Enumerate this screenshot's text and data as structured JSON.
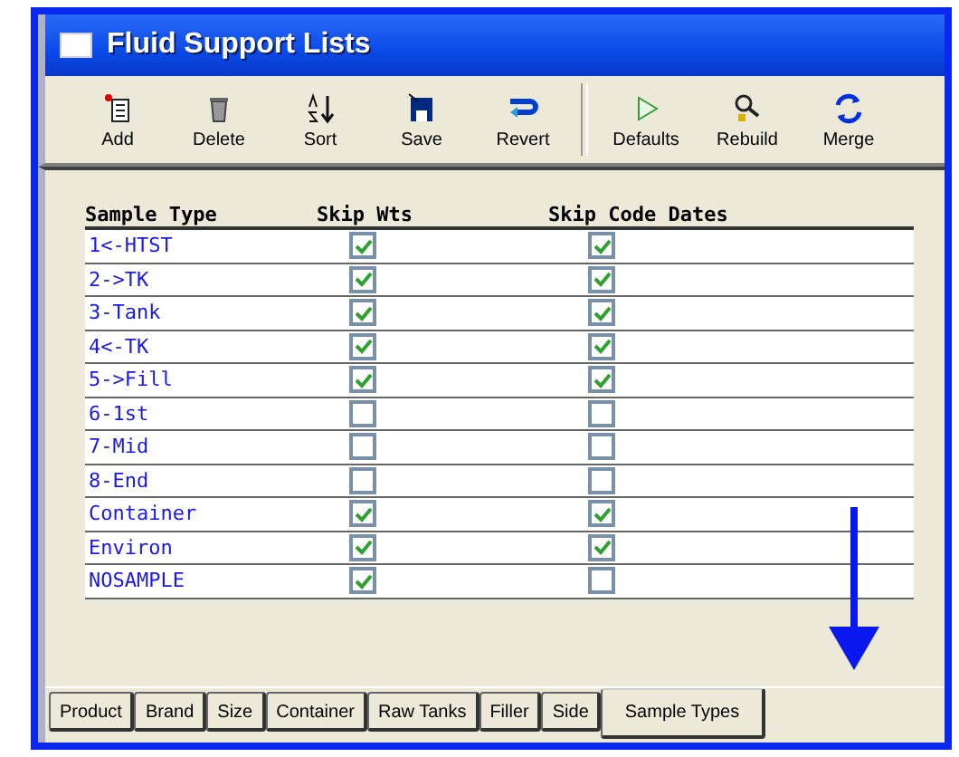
{
  "window": {
    "title": "Fluid Support Lists"
  },
  "toolbar": [
    {
      "label": "Add",
      "kind": "add"
    },
    {
      "label": "Delete",
      "kind": "delete"
    },
    {
      "label": "Sort",
      "kind": "sort"
    },
    {
      "label": "Save",
      "kind": "save"
    },
    {
      "label": "Revert",
      "kind": "revert"
    },
    {
      "label": "Defaults",
      "kind": "defaults"
    },
    {
      "label": "Rebuild",
      "kind": "rebuild"
    },
    {
      "label": "Merge",
      "kind": "merge"
    }
  ],
  "table": {
    "columns": [
      "Sample Type",
      "Skip Wts",
      "Skip Code Dates"
    ],
    "rows": [
      {
        "sample_type": "1<-HTST",
        "skip_wts": true,
        "skip_code_dates": true
      },
      {
        "sample_type": "2->TK",
        "skip_wts": true,
        "skip_code_dates": true
      },
      {
        "sample_type": "3-Tank",
        "skip_wts": true,
        "skip_code_dates": true
      },
      {
        "sample_type": "4<-TK",
        "skip_wts": true,
        "skip_code_dates": true
      },
      {
        "sample_type": "5->Fill",
        "skip_wts": true,
        "skip_code_dates": true
      },
      {
        "sample_type": "6-1st",
        "skip_wts": false,
        "skip_code_dates": false
      },
      {
        "sample_type": "7-Mid",
        "skip_wts": false,
        "skip_code_dates": false
      },
      {
        "sample_type": "8-End",
        "skip_wts": false,
        "skip_code_dates": false
      },
      {
        "sample_type": "Container",
        "skip_wts": true,
        "skip_code_dates": true
      },
      {
        "sample_type": "Environ",
        "skip_wts": true,
        "skip_code_dates": true
      },
      {
        "sample_type": "NOSAMPLE",
        "skip_wts": true,
        "skip_code_dates": false
      }
    ]
  },
  "tabs": [
    {
      "label": "Product",
      "selected": false
    },
    {
      "label": "Brand",
      "selected": false
    },
    {
      "label": "Size",
      "selected": false
    },
    {
      "label": "Container",
      "selected": false
    },
    {
      "label": "Raw Tanks",
      "selected": false
    },
    {
      "label": "Filler",
      "selected": false
    },
    {
      "label": "Side",
      "selected": false
    },
    {
      "label": "Sample Types",
      "selected": true
    }
  ]
}
